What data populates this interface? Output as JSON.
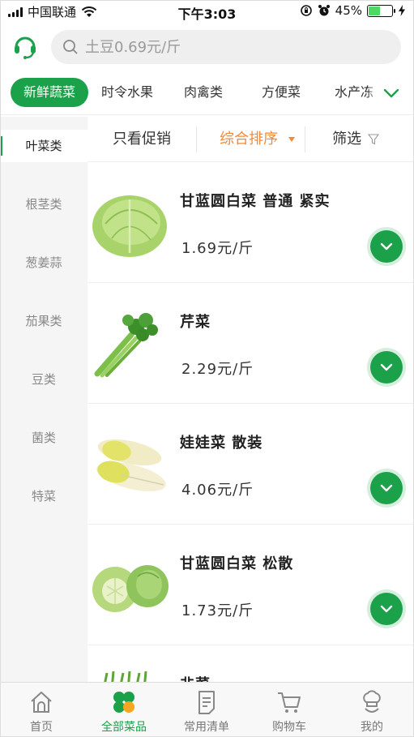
{
  "status_bar": {
    "carrier": "中国联通",
    "time": "下午3:03",
    "battery_percent": "45%",
    "battery_level": 0.45,
    "icons": [
      "signal-icon",
      "wifi-icon",
      "rotation-lock-icon",
      "alarm-icon",
      "battery-icon",
      "charging-icon"
    ]
  },
  "search": {
    "placeholder": "土豆0.69元/斤"
  },
  "category_tabs": [
    {
      "label": "新鲜蔬菜",
      "active": true
    },
    {
      "label": "时令水果",
      "active": false
    },
    {
      "label": "肉禽类",
      "active": false
    },
    {
      "label": "方便菜",
      "active": false
    },
    {
      "label": "水产冻",
      "active": false
    }
  ],
  "sidebar": {
    "items": [
      {
        "label": "叶菜类",
        "active": true
      },
      {
        "label": "根茎类",
        "active": false
      },
      {
        "label": "葱姜蒜",
        "active": false
      },
      {
        "label": "茄果类",
        "active": false
      },
      {
        "label": "豆类",
        "active": false
      },
      {
        "label": "菌类",
        "active": false
      },
      {
        "label": "特菜",
        "active": false
      }
    ]
  },
  "filters": {
    "promo_only": "只看促销",
    "sort": "综合排序",
    "filter": "筛选"
  },
  "products": [
    {
      "name": "甘蓝圆白菜 普通 紧实",
      "price": "1.69元/斤",
      "image": "cabbage"
    },
    {
      "name": "芹菜",
      "price": "2.29元/斤",
      "image": "celery"
    },
    {
      "name": "娃娃菜 散装",
      "price": "4.06元/斤",
      "image": "baby-cabbage"
    },
    {
      "name": "甘蓝圆白菜 松散",
      "price": "1.73元/斤",
      "image": "loose-cabbage"
    },
    {
      "name": "韭菜",
      "price": "",
      "image": "chives"
    }
  ],
  "bottom_nav": [
    {
      "label": "首页",
      "icon": "home-icon",
      "active": false
    },
    {
      "label": "全部菜品",
      "icon": "all-dishes-icon",
      "active": true
    },
    {
      "label": "常用清单",
      "icon": "list-icon",
      "active": false
    },
    {
      "label": "购物车",
      "icon": "cart-icon",
      "active": false
    },
    {
      "label": "我的",
      "icon": "chef-hat-icon",
      "active": false
    }
  ],
  "colors": {
    "accent": "#1aa14a",
    "sort_active": "#f08a3a",
    "sidebar_bg": "#f5f5f5"
  }
}
